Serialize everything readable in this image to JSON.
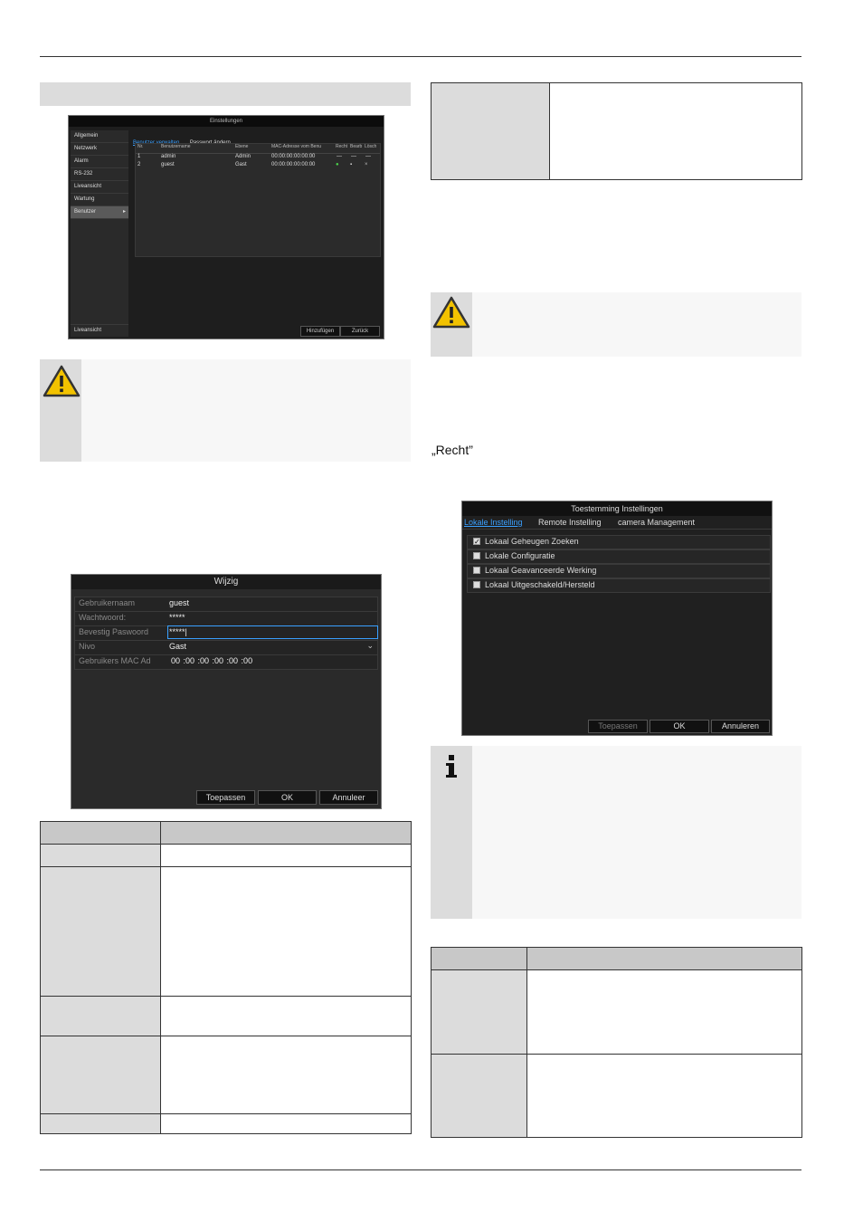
{
  "page": {
    "quote_recht": "„Recht”"
  },
  "screenshot1": {
    "title": "Einstellungen",
    "sidebar": [
      "Allgemein",
      "Netzwerk",
      "Alarm",
      "RS-232",
      "Liveansicht",
      "Wartung",
      "Benutzer"
    ],
    "sidebar_bottom": "Liveansicht",
    "tabs": [
      "Benutzer verwalten",
      "Passwort ändern"
    ],
    "columns": [
      "Nr.",
      "Benutzername",
      "Ebene",
      "MAC-Adresse vom Benu",
      "Recht",
      "Bearb",
      "Lösch"
    ],
    "rows": [
      {
        "nr": "1",
        "name": "admin",
        "level": "Admin",
        "mac": "00:00:00:00:00:00",
        "a": "—",
        "b": "—",
        "c": "—"
      },
      {
        "nr": "2",
        "name": "guest",
        "level": "Gast",
        "mac": "00:00:00:00:00:00",
        "a": "●",
        "b": "▪",
        "c": "×"
      }
    ],
    "buttons": {
      "add": "Hinzufügen",
      "back": "Zurück"
    }
  },
  "screenshot2": {
    "title": "Wijzig",
    "fields": [
      {
        "label": "Gebruikernaam",
        "value": "guest"
      },
      {
        "label": "Wachtwoord:",
        "value": "*****"
      },
      {
        "label": "Bevestig Paswoord",
        "value": "*****|"
      },
      {
        "label": "Nivo",
        "value": "Gast"
      },
      {
        "label": "Gebruikers MAC Ad",
        "value": "00 :00 :00 :00 :00 :00"
      }
    ],
    "buttons": {
      "apply": "Toepassen",
      "ok": "OK",
      "cancel": "Annuleer"
    }
  },
  "screenshot3": {
    "title": "Toestemming Instellingen",
    "tabs": [
      "Lokale Instelling",
      "Remote Instelling",
      "camera Management"
    ],
    "options": [
      {
        "label": "Lokaal Geheugen Zoeken",
        "checked": true
      },
      {
        "label": "Lokale Configuratie",
        "checked": false
      },
      {
        "label": "Lokaal Geavanceerde Werking",
        "checked": false
      },
      {
        "label": "Lokaal Uitgeschakeld/Hersteld",
        "checked": false
      }
    ],
    "buttons": {
      "apply": "Toepassen",
      "ok": "OK",
      "cancel": "Annuleren"
    }
  },
  "icons": {
    "warning": "warning-triangle-icon",
    "info": "info-icon",
    "accent": "#f2c200"
  }
}
